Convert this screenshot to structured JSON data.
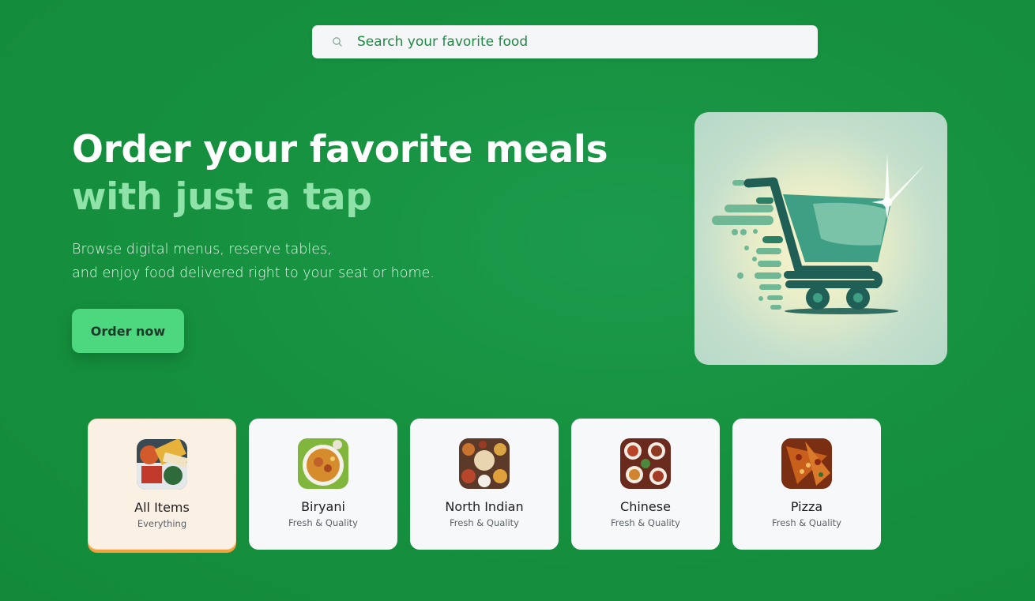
{
  "search": {
    "placeholder": "Search your favorite food",
    "icon": "search-icon"
  },
  "hero": {
    "title_line1": "Order your favorite meals",
    "title_line2": "with just a tap",
    "subtitle_line1": "Browse digital menus, reserve tables,",
    "subtitle_line2": "and enjoy food delivered right to your seat or home.",
    "cta_label": "Order now",
    "image": "shopping-cart-illustration"
  },
  "colors": {
    "background": "#16913f",
    "accent_text": "#8fe3a8",
    "cta": "#4dd77f",
    "active_underline": "#f2a23a"
  },
  "categories": [
    {
      "name": "All Items",
      "tag": "Everything",
      "active": true
    },
    {
      "name": "Biryani",
      "tag": "Fresh & Quality",
      "active": false
    },
    {
      "name": "North Indian",
      "tag": "Fresh & Quality",
      "active": false
    },
    {
      "name": "Chinese",
      "tag": "Fresh & Quality",
      "active": false
    },
    {
      "name": "Pizza",
      "tag": "Fresh & Quality",
      "active": false
    }
  ]
}
